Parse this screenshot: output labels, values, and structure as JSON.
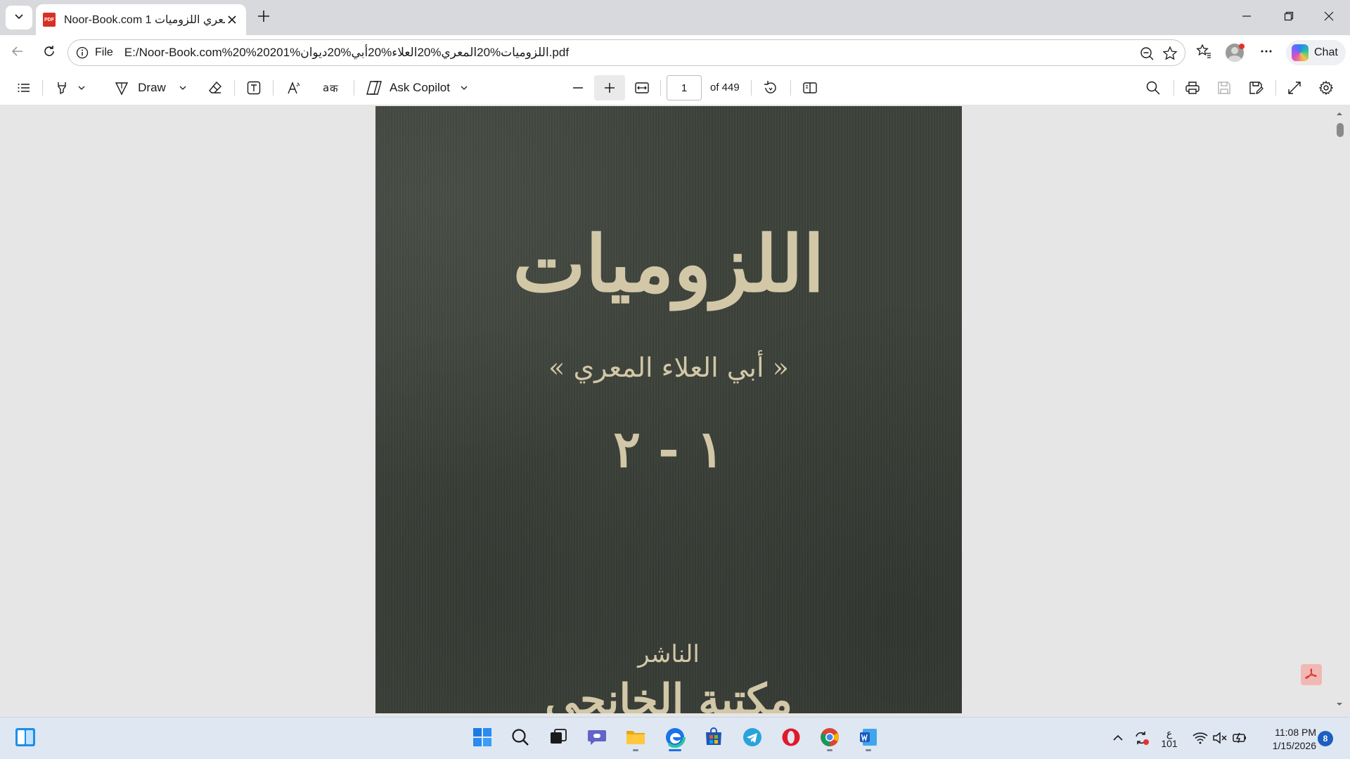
{
  "browser": {
    "tab": {
      "title": "Noor-Book.com المعري اللزوميات 1",
      "favicon_label": "PDF"
    },
    "address_bar": {
      "scheme_label": "File",
      "url": "E:/Noor-Book.com%20%20201%اللزوميات%20المعري%20العلاء%20أبي%20ديوان.pdf"
    },
    "chat_label": "Chat"
  },
  "pdf_toolbar": {
    "draw_label": "Draw",
    "ask_copilot_label": "Ask Copilot",
    "page_number": "1",
    "page_count_label": "of 449"
  },
  "pdf_page": {
    "title": "اللزوميات",
    "author": "« أبي العلاء المعري »",
    "volumes": "١ - ٢",
    "publisher_label": "الناشر",
    "publisher_name": "مكتبة الخانجي"
  },
  "taskbar": {
    "keyboard_lang": "ع",
    "keyboard_sub": "101",
    "time": "11:08 PM",
    "date": "1/15/2026",
    "notification_count": "8"
  },
  "colors": {
    "cover_green": "#3d423b",
    "cover_gold": "#d2c7a7",
    "edge_blue": "#1a73e8",
    "opera_red": "#e0192b"
  }
}
